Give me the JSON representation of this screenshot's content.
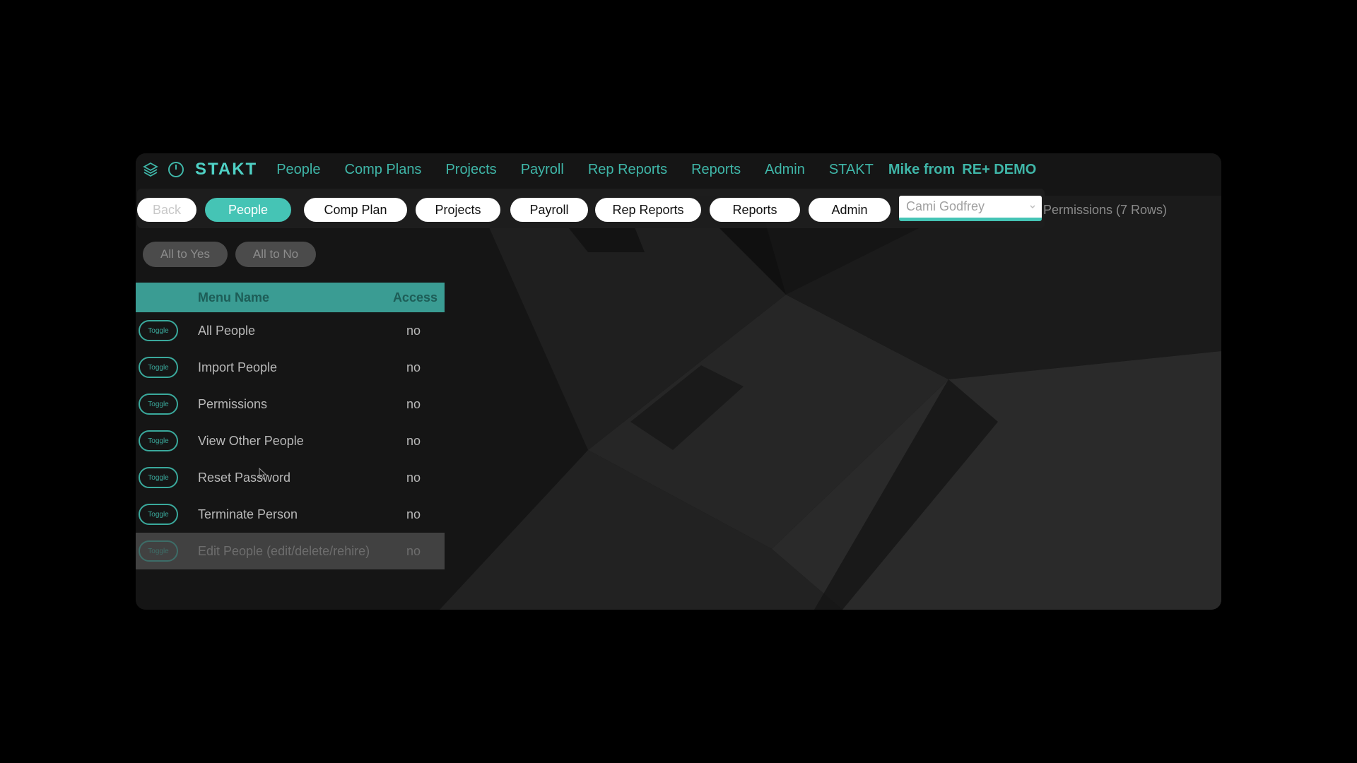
{
  "topnav": {
    "brand": "STAKT",
    "links": [
      "People",
      "Comp Plans",
      "Projects",
      "Payroll",
      "Rep Reports",
      "Reports",
      "Admin",
      "STAKT"
    ],
    "user_prefix": "Mike from",
    "user_org": "RE+ DEMO",
    "icons": [
      "layers-icon",
      "power-icon"
    ]
  },
  "tabs": {
    "back": "Back",
    "items": [
      "People",
      "Comp Plan",
      "Projects",
      "Payroll",
      "Rep Reports",
      "Reports",
      "Admin"
    ],
    "active": "People"
  },
  "user_select": {
    "value": "Cami Godfrey"
  },
  "permissions_label": "Permissions  (7 Rows)",
  "bulk": {
    "all_yes": "All to Yes",
    "all_no": "All to No"
  },
  "table": {
    "headers": {
      "menu_name": "Menu Name",
      "access": "Access"
    },
    "toggle_label": "Toggle",
    "rows": [
      {
        "name": "All People",
        "access": "no"
      },
      {
        "name": "Import People",
        "access": "no"
      },
      {
        "name": "Permissions",
        "access": "no"
      },
      {
        "name": "View Other People",
        "access": "no"
      },
      {
        "name": "Reset Password",
        "access": "no"
      },
      {
        "name": "Terminate Person",
        "access": "no"
      },
      {
        "name": "Edit People (edit/delete/rehire)",
        "access": "no"
      }
    ]
  },
  "colors": {
    "accent": "#45c4b5",
    "header_bg": "#3a9c93",
    "background": "#000000"
  }
}
